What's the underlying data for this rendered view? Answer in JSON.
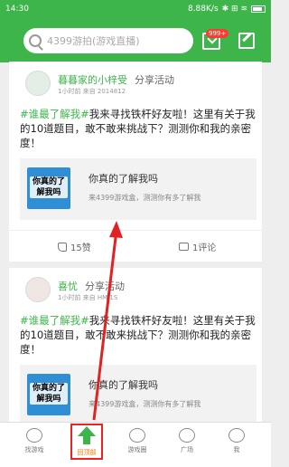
{
  "status": {
    "time": "14:30",
    "net": "8.88K/s",
    "icons": "✱ ⊞ ≋"
  },
  "header": {
    "search_placeholder": "4399游拍(游戏直播)",
    "badge": "999+",
    "accent": "#3db54a"
  },
  "feed": [
    {
      "user": "暮暮家的小梓受",
      "action": "分享活动",
      "meta": "1小时前  来自 2014812",
      "hashtag": "#谁最了解我#",
      "text": "我来寻找铁杆好友啦！这里有关于我的10道题目，敢不敢来挑战下？测测你和我的亲密度！",
      "share_title": "你真的了解我吗",
      "share_desc": "来4399游戏盒，测测你有多了解我",
      "thumb_text": "你真的了解我吗",
      "likes": "15赞",
      "comments": "1评论"
    },
    {
      "user": "喜忧",
      "action": "分享活动",
      "meta": "1小时前  来自 HM 1S",
      "hashtag": "#谁最了解我#",
      "text": "我来寻找铁杆好友啦！这里有关于我的10道题目，敢不敢来挑战下？测测你和我的亲密度！",
      "share_title": "你真的了解我吗",
      "share_desc": "来4399游戏盒，测测你有多了解我",
      "thumb_text": "你真的了解我吗"
    }
  ],
  "nav": {
    "items": [
      {
        "label": "找游戏",
        "icon": "gamepad-icon"
      },
      {
        "label": "回顶部",
        "icon": "up-arrow-icon"
      },
      {
        "label": "游戏圈",
        "icon": "circle-icon"
      },
      {
        "label": "广场",
        "icon": "plaza-icon"
      },
      {
        "label": "我",
        "icon": "user-icon"
      }
    ],
    "active_index": 1
  },
  "annotation_color": "#e22222"
}
